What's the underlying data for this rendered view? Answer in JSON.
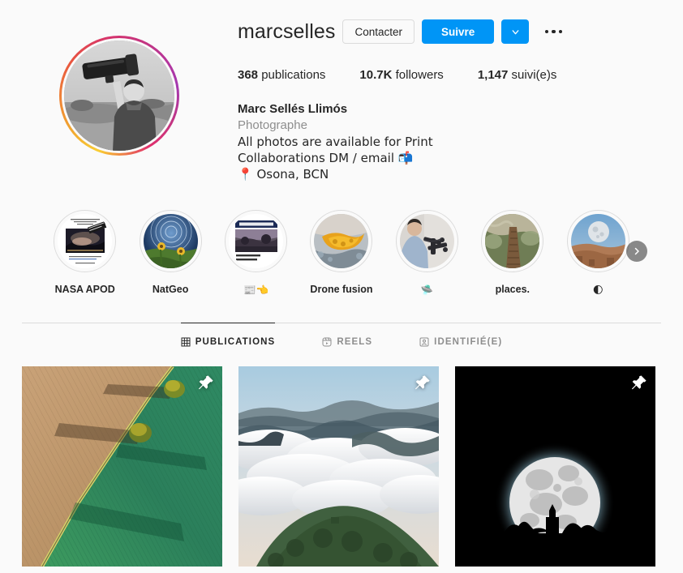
{
  "profile": {
    "username": "marcselles",
    "full_name": "Marc Sellés Llimós",
    "category": "Photographe",
    "bio_lines": [
      "All photos are available for Print",
      "Collaborations DM / email 📬"
    ],
    "location": "📍 Osona, BCN",
    "avatar_alt": "avatar-photographer-holding-telephoto-lens"
  },
  "actions": {
    "contact_label": "Contacter",
    "follow_label": "Suivre",
    "dropdown_icon": "chevron-down-icon",
    "options_icon": "more-options-icon"
  },
  "stats": [
    {
      "value": "368",
      "label": "publications",
      "name": "posts"
    },
    {
      "value": "10.7K",
      "label": "followers",
      "name": "followers"
    },
    {
      "value": "1,147",
      "label": "suivi(e)s",
      "name": "following"
    }
  ],
  "highlights": [
    {
      "label": "NASA APOD",
      "thumb": "storm-lightning-award-card"
    },
    {
      "label": "NatGeo",
      "thumb": "star-trails-sunflower-field"
    },
    {
      "label": "📰👈",
      "thumb": "newspaper-lavanguardia-clipping"
    },
    {
      "label": "Drone fusion",
      "thumb": "aerial-orange-blue-abstract"
    },
    {
      "label": "🛸",
      "thumb": "man-holding-drone-indoors"
    },
    {
      "label": "places.",
      "thumb": "wooden-boardwalk-path"
    },
    {
      "label": "🌓",
      "thumb": "moon-over-desert-ridge"
    }
  ],
  "highlights_next_icon": "chevron-right-icon",
  "tabs": [
    {
      "label": "PUBLICATIONS",
      "icon": "grid-icon",
      "active": true
    },
    {
      "label": "REELS",
      "icon": "reels-icon",
      "active": false
    },
    {
      "label": "IDENTIFIÉ(E)",
      "icon": "tagged-icon",
      "active": false
    }
  ],
  "posts": [
    {
      "alt": "aerial-farmland-brown-and-green-fields-with-tree-shadows",
      "pinned": true,
      "pin_icon": "pin-icon"
    },
    {
      "alt": "sea-of-clouds-over-mountain-ridges-at-dawn",
      "pinned": true,
      "pin_icon": "pin-icon"
    },
    {
      "alt": "full-moon-rising-behind-silhouetted-trees-and-chapel",
      "pinned": true,
      "pin_icon": "pin-icon"
    }
  ],
  "colors": {
    "accent": "#0095f6",
    "background": "#fafafa",
    "text": "#262626",
    "muted": "#8e8e8e",
    "border": "#dbdbdb"
  }
}
